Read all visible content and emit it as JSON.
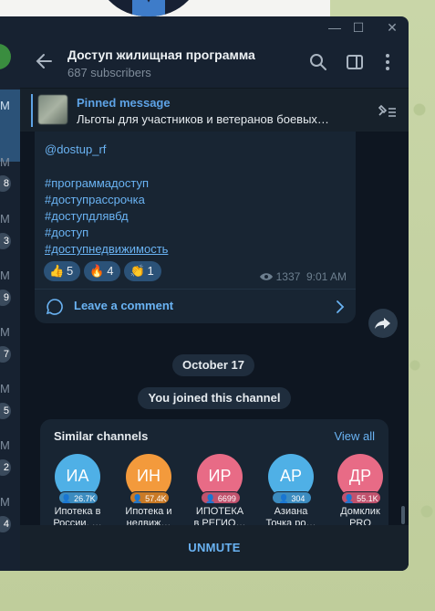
{
  "window_controls": {
    "minimize": "—",
    "maximize": "☐",
    "close": "✕"
  },
  "left_strip": {
    "times": [
      "M",
      "M",
      "M",
      "M",
      "M",
      "M",
      "M",
      "M"
    ],
    "badges": [
      "8",
      "3",
      "9",
      "7",
      "5",
      "2",
      "4"
    ]
  },
  "header": {
    "title": "Доступ жилищная программа",
    "subtitle": "687 subscribers"
  },
  "pinned": {
    "label": "Pinned message",
    "text": "Льготы для участников и ветеранов боевых…"
  },
  "message": {
    "mention": "@dostup_rf",
    "hashtags": [
      "#программадоступ",
      "#доступрассрочка",
      "#доступдлявбд",
      "#доступ",
      "#доступнедвижимость"
    ],
    "reactions": [
      {
        "emoji": "👍",
        "count": "5"
      },
      {
        "emoji": "🔥",
        "count": "4"
      },
      {
        "emoji": "👏",
        "count": "1"
      }
    ],
    "views": "1337",
    "time": "9:01 AM",
    "comment_label": "Leave a comment"
  },
  "service": {
    "date": "October 17",
    "joined": "You joined this channel"
  },
  "similar": {
    "title": "Similar channels",
    "view_all": "View all",
    "channels": [
      {
        "initials": "ИА",
        "count": "26.7K",
        "line1": "Ипотека в",
        "line2": "России. …",
        "color": "#4fb0e6",
        "badge": "#3c8cc0"
      },
      {
        "initials": "ИН",
        "count": "57.4K",
        "line1": "Ипотека и",
        "line2": "недвиж…",
        "color": "#f39a3c",
        "badge": "#c97a26"
      },
      {
        "initials": "ИР",
        "count": "6699",
        "line1": "ИПОТЕКА",
        "line2": "в РЕГИО…",
        "color": "#e86b86",
        "badge": "#c0526d"
      },
      {
        "initials": "АР",
        "count": "304",
        "line1": "Азиана",
        "line2": "Точка ро…",
        "color": "#4fb0e6",
        "badge": "#3c8cc0"
      },
      {
        "initials": "ДР",
        "count": "55.1K",
        "line1": "Домклик",
        "line2": "PRO",
        "color": "#e86b86",
        "badge": "#c0526d"
      }
    ]
  },
  "bottom": {
    "unmute": "UNMUTE"
  }
}
